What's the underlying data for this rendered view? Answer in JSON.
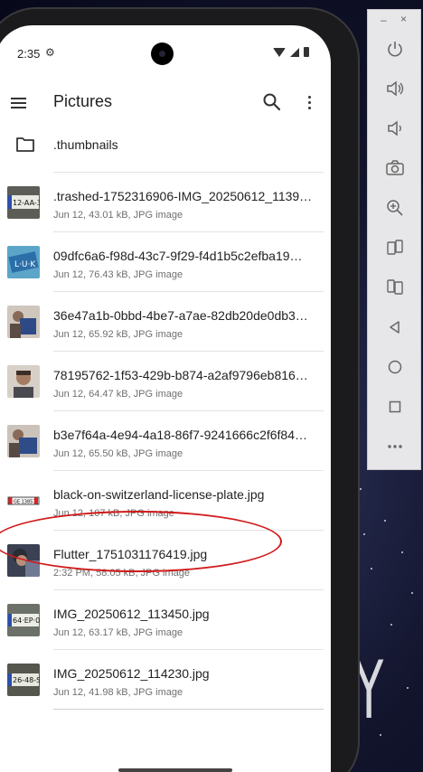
{
  "status_bar": {
    "time": "2:35",
    "settings_icon": "settings-gear-icon",
    "icons": [
      "wifi-icon",
      "signal-icon",
      "battery-icon"
    ]
  },
  "app_bar": {
    "title": "Pictures",
    "menu_icon": "menu-icon",
    "search_icon": "search-icon",
    "more_icon": "more-vert-icon"
  },
  "folder": {
    "name": ".thumbnails",
    "icon": "folder-icon"
  },
  "files": [
    {
      "name": ".trashed-1752316906-IMG_20250612_1139…",
      "meta": "Jun 12, 43.01 kB, JPG image",
      "thumb": "license-plate"
    },
    {
      "name": "09dfc6a6-f98d-43c7-9f29-f4d1b5c2efba19…",
      "meta": "Jun 12, 76.43 kB, JPG image",
      "thumb": "blue-card"
    },
    {
      "name": "36e47a1b-0bbd-4be7-a7ae-82db20de0db3…",
      "meta": "Jun 12, 65.92 kB, JPG image",
      "thumb": "person-card"
    },
    {
      "name": "78195762-1f53-429b-b874-a2af9796eb816…",
      "meta": "Jun 12, 64.47 kB, JPG image",
      "thumb": "person"
    },
    {
      "name": "b3e7f64a-4e94-4a18-86f7-9241666c2f6f84…",
      "meta": "Jun 12, 65.50 kB, JPG image",
      "thumb": "person-card"
    },
    {
      "name": "black-on-switzerland-license-plate.jpg",
      "meta": "Jun 12, 107 kB, JPG image",
      "thumb": "swiss-plate"
    },
    {
      "name": "Flutter_1751031176419.jpg",
      "meta": "2:32 PM, 58.05 kB, JPG image",
      "thumb": "person-dark"
    },
    {
      "name": "IMG_20250612_113450.jpg",
      "meta": "Jun 12, 63.17 kB, JPG image",
      "thumb": "license-plate-2"
    },
    {
      "name": "IMG_20250612_114230.jpg",
      "meta": "Jun 12, 41.98 kB, JPG image",
      "thumb": "license-plate-3"
    }
  ],
  "emulator_panel": {
    "minimize": "–",
    "close": "×",
    "buttons": [
      "power-icon",
      "volume-up-icon",
      "volume-down-icon",
      "camera-icon",
      "zoom-icon",
      "rotate-left-icon",
      "rotate-right-icon",
      "back-icon",
      "home-icon",
      "overview-icon",
      "more-horiz-icon"
    ]
  },
  "background_letter": "Y",
  "colors": {
    "annotation": "#d11a1a",
    "screen_bg": "#ffffff",
    "panel_bg": "#e7e7e9"
  }
}
